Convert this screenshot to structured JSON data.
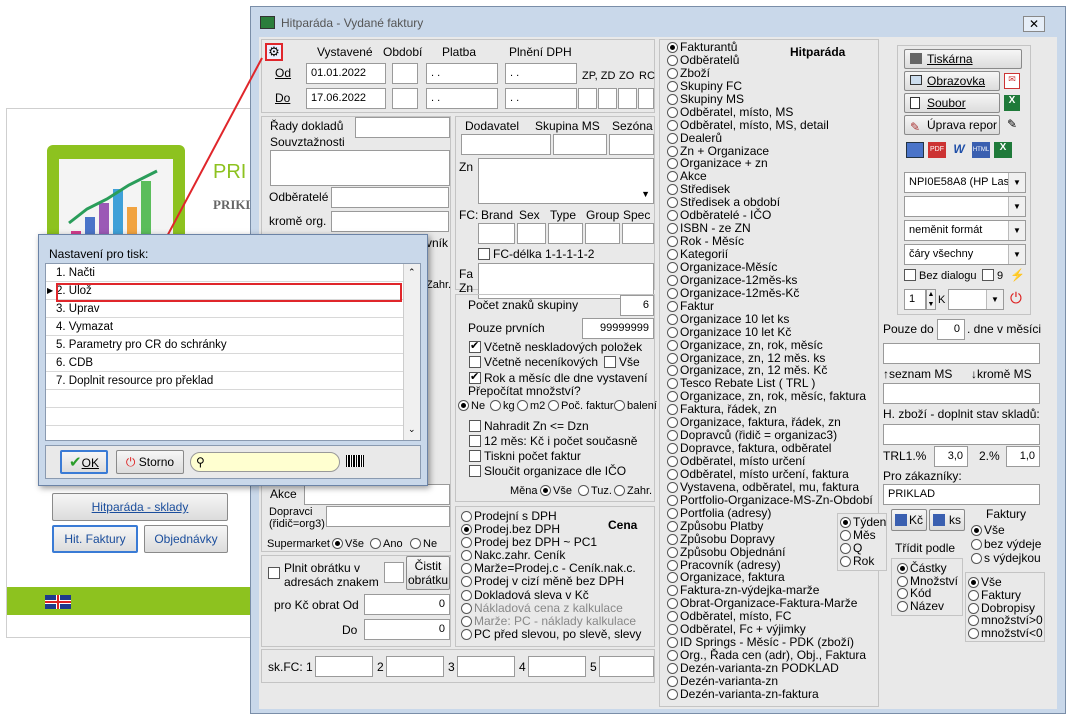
{
  "bg": {
    "title_part": "PRI",
    "subtitle_part": "PRIKL"
  },
  "bg_buttons": {
    "skladу": "Hitparáda - sklady",
    "hit_faktury": "Hit. Faktury",
    "objednavky": "Objednávky"
  },
  "main": {
    "title": "Hitparáda - Vydané faktury",
    "hdr": {
      "vystavene": "Vystavené",
      "obdobi": "Období",
      "platba": "Platba",
      "plneni": "Plnění DPH",
      "od": "Od",
      "do": "Do",
      "od_val": "01.01.2022",
      "do_val": "17.06.2022",
      "dots": ". .",
      "zp": "ZP, ZD",
      "zo": "ZO",
      "rc": "RC"
    },
    "left": {
      "rady": "Řady dokladů",
      "souv": "Souvztažnosti",
      "odberatele": "Odběratelé",
      "krome": "kromě org.",
      "vnik": "vník",
      "zahr": "Zahr.",
      "akce": "Akce",
      "dopravci": "Dopravci",
      "ridic": "(řidič=org3)",
      "supermarket": "Supermarket",
      "vse": "Vše",
      "ano": "Ano",
      "ne": "Ne",
      "plnit": "Plnit obrátku v adresách znakem",
      "cistit": "Čistit obrátku",
      "prokc": "pro Kč obrat Od",
      "do": "Do",
      "od_val": "0",
      "do_val": "0"
    },
    "mid": {
      "dodavatel": "Dodavatel",
      "skupina": "Skupina MS",
      "sezona": "Sezóna",
      "zn": "Zn",
      "fc": "FC:",
      "brand": "Brand",
      "sex": "Sex",
      "type": "Type",
      "group": "Group",
      "spec": "Spec",
      "fcdelka": "FC-délka 1-1-1-1-2",
      "fa": "Fa",
      "zn2": "Zn",
      "pocet": "Počet znaků skupiny",
      "pocet_val": "6",
      "pouze": "Pouze prvních",
      "pouze_val": "99999999",
      "vcetne_nesk": "Včetně neskladových položek",
      "vcetne_necen": "Včetně neceníkových",
      "vse": "Vše",
      "rok": "Rok a měsíc dle dne vystavení",
      "prepocitat": "Přepočítat množství?",
      "ne": "Ne",
      "kg": "kg",
      "m2": "m2",
      "poc": "Poč. faktur",
      "baleni": "balení",
      "nahradit": "Nahradit Zn <= Dzn",
      "mes12": "12 měs: Kč i počet současně",
      "tiskni": "Tiskni počet faktur",
      "sloucit": "Sloučit organizace dle IČO",
      "mena": "Měna",
      "mvse": "Vše",
      "tuz": "Tuz.",
      "zahr": "Zahr."
    },
    "cena": {
      "title": "Cena",
      "items": [
        "Prodejní s DPH",
        "Prodej.bez DPH",
        "Prodej bez DPH ~ PC1",
        "Nakc.zahr. Ceník",
        "Marže=Prodej.c - Ceník.nak.c.",
        "Prodej v cizí měně bez DPH",
        "Dokladová sleva v Kč",
        "Nákladová cena z kalkulace",
        "Marže: PC - náklady kalkulace",
        "PC před slevou, po slevě, slevy"
      ]
    },
    "skfc": {
      "label": "sk.FC: 1",
      "n2": "2",
      "n3": "3",
      "n4": "4",
      "n5": "5"
    },
    "hit": {
      "title": "Hitparáda",
      "items": [
        "Fakturantů",
        "Odběratelů",
        "Zboží",
        "Skupiny FC",
        "Skupiny MS",
        "Odběratel, místo, MS",
        "Odběratel, místo, MS, detail",
        "Dealerů",
        "Zn + Organizace",
        "Organizace + zn",
        "Akce",
        "Středisek",
        "Středisek a období",
        "Odběratelé - IČO",
        "ISBN - ze ZN",
        "Rok - Měsíc",
        "Kategorií",
        "Organizace-Měsíc",
        "Organizace-12měs-ks",
        "Organizace-12měs-Kč",
        "Faktur",
        "Organizace 10 let ks",
        "Organizace 10 let Kč",
        "Organizace, zn, rok, měsíc",
        "Organizace, zn, 12 měs. ks",
        "Organizace, zn, 12 měs. Kč",
        "Tesco Rebate List ( TRL )",
        "Organizace, zn, rok, měsíc, faktura",
        "Faktura, řádek, zn",
        "Organizace, faktura, řádek, zn",
        "Dopravců (řidič = organizac3)",
        "Dopravce, faktura, odběratel",
        "Odběratel, místo určení",
        "Odběratel, místo určení, faktura",
        "Vystavena, odběratel, mu, faktura",
        "Portfolio-Organizace-MS-Zn-Období",
        "Portfolia (adresy)",
        "Způsobu Platby",
        "Způsobu Dopravy",
        "Způsobu Objednání",
        "Pracovník (adresy)",
        "Organizace, faktura",
        "Faktura-zn-výdejka-marže",
        "Obrat-Organizace-Faktura-Marže",
        "Odběratel, místo, FC",
        "Odběratel, Fc + výjimky",
        "ID  Springs - Měsíc - PDK (zboží)",
        "Org., Řada cen (adr), Obj., Faktura",
        "Dezén-varianta-zn PODKLAD",
        "Dezén-varianta-zn",
        "Dezén-varianta-zn-faktura"
      ],
      "period": [
        "Týden",
        "Měs",
        "Q",
        "Rok"
      ]
    },
    "right": {
      "tiskarna": "Tiskárna",
      "obrazovka": "Obrazovka",
      "soubor": "Soubor",
      "uprava": "Úprava repor",
      "printer": "NPI0E58A8 (HP Lase",
      "nemenit": "neměnit formát",
      "cary": "čáry všechny",
      "bez": "Bez dialogu",
      "nine": "9",
      "one": "1",
      "k": "K",
      "pouze_do": "Pouze do",
      "pouze_do_val": "0",
      "dne": ". dne v měsíci",
      "seznam": "↑seznam MS",
      "krome": "↓kromě MS",
      "hzbozi": "H. zboží - doplnit stav skladů:",
      "trl": "TRL1.%",
      "trl_val": "3,0",
      "p2": "2.%",
      "p2_val": "1,0",
      "pro_zak": "Pro zákazníky:",
      "priklad": "PRIKLAD",
      "kc": "Kč",
      "ks": "ks",
      "faktury": "Faktury",
      "fvse": "Vše",
      "bez_vyd": "bez výdeje",
      "s_vyd": "s výdejkou",
      "tridit": "Třídit podle",
      "tr": [
        "Částky",
        "Množství",
        "Kód",
        "Název"
      ],
      "f2": [
        "Vše",
        "Faktury",
        "Dobropisy",
        "množství>0",
        "množství<0"
      ]
    }
  },
  "dialog": {
    "title": "Nastavení pro tisk:",
    "items": [
      "1. Načti",
      "2. Ulož",
      "3. Uprav",
      "4. Vymazat",
      "5. Parametry pro CR do schránky",
      "6. CDB",
      "7. Doplnit resource pro překlad"
    ],
    "ok": "OK",
    "storno": "Storno",
    "search_value": ""
  },
  "colors": {
    "accent": "#e0262b",
    "win_bg": "#e9e9e9",
    "frame": "#c9d8ea",
    "green": "#8dc21f"
  }
}
